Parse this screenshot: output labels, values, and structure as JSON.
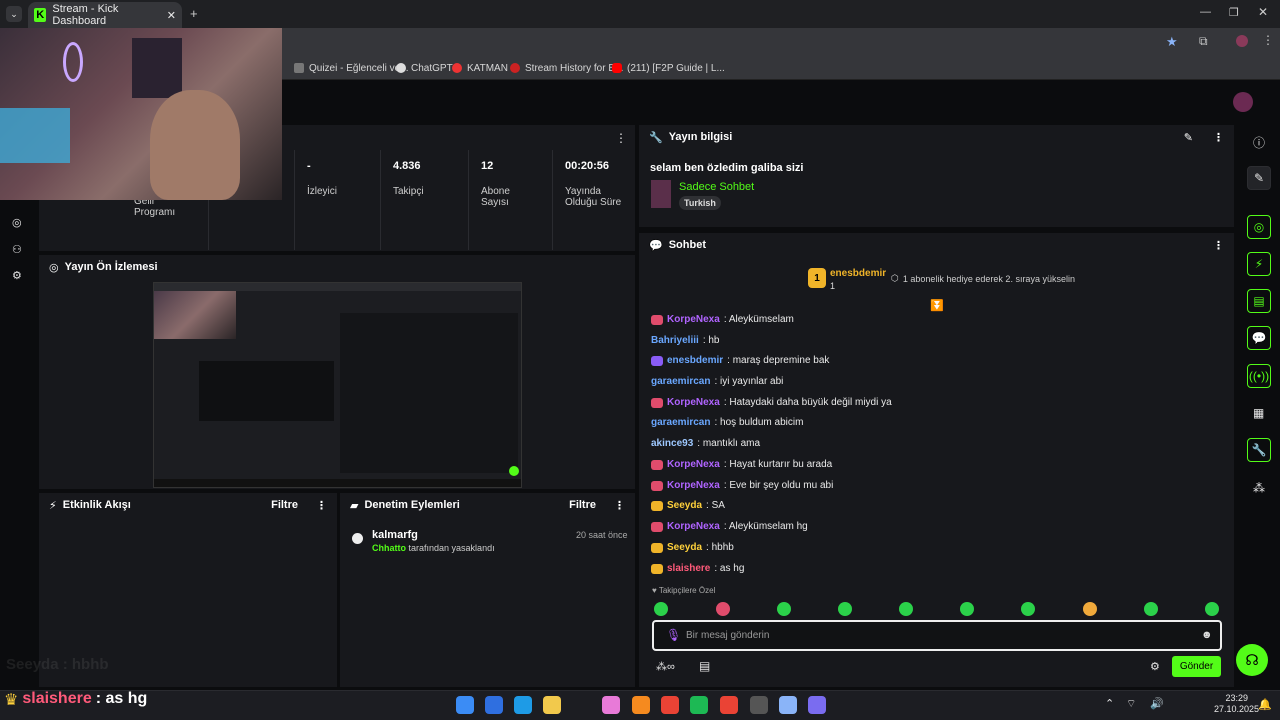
{
  "browser": {
    "tab_title": "Stream - Kick Dashboard",
    "bookmarks": [
      "Quizei - Eğlenceli ve...",
      "ChatGPT",
      "KATMAN",
      "Stream History for B...",
      "(211) [F2P Guide | L..."
    ]
  },
  "stats": [
    {
      "value": "",
      "label": "Gelir Programı"
    },
    {
      "value": "-",
      "label": "İzleyici"
    },
    {
      "value": "4.836",
      "label": "Takipçi"
    },
    {
      "value": "12",
      "label": "Abone Sayısı"
    },
    {
      "value": "00:20:56",
      "label": "Yayında Olduğu Süre"
    }
  ],
  "preview": {
    "title": "Yayın Ön İzlemesi"
  },
  "activity": {
    "title": "Etkinlik Akışı",
    "filter": "Filtre"
  },
  "moderation": {
    "title": "Denetim Eylemleri",
    "filter": "Filtre",
    "item": {
      "user": "kalmarfg",
      "by": "Chhatto",
      "action": "tarafından yasaklandı",
      "time": "20 saat önce"
    }
  },
  "stream_info": {
    "title": "Yayın bilgisi",
    "stream_title": "selam ben özledim galiba sizi",
    "category": "Sadece Sohbet",
    "language": "Turkish"
  },
  "chat": {
    "title": "Sohbet",
    "pinned_user": "enesbdemir",
    "pinned_count": "1",
    "gift_text": "1 abonelik hediye ederek 2. sıraya yükselin",
    "messages": [
      {
        "user": "KorpeNexa",
        "color": "#b064ff",
        "text": ": Aleykümselam"
      },
      {
        "user": "Bahriyeliii",
        "color": "#6aa7ff",
        "text": ": hb"
      },
      {
        "user": "enesbdemir",
        "color": "#6aa7ff",
        "text": ": maraş depremine bak"
      },
      {
        "user": "garaemircan",
        "color": "#6aa7ff",
        "text": ": iyi yayınlar abi"
      },
      {
        "user": "KorpeNexa",
        "color": "#b064ff",
        "text": ": Hataydaki daha büyük değil miydi ya"
      },
      {
        "user": "garaemircan",
        "color": "#6aa7ff",
        "text": ": hoş buldum abicim"
      },
      {
        "user": "akince93",
        "color": "#9ec8ff",
        "text": ": mantıklı ama"
      },
      {
        "user": "KorpeNexa",
        "color": "#b064ff",
        "text": ": Hayat kurtarır bu arada"
      },
      {
        "user": "KorpeNexa",
        "color": "#b064ff",
        "text": ": Eve bir şey oldu mu abi"
      },
      {
        "user": "Seeyda",
        "color": "#ffd13b",
        "text": ": SA"
      },
      {
        "user": "KorpeNexa",
        "color": "#b064ff",
        "text": ": Aleykümselam hg"
      },
      {
        "user": "Seeyda",
        "color": "#ffd13b",
        "text": ": hbhb"
      },
      {
        "user": "slaishere",
        "color": "#ff5a7a",
        "text": ": as hg"
      }
    ],
    "followers_only": "Takipçilere Özel",
    "input_placeholder": "Bir mesaj gönderin",
    "send_label": "Gönder"
  },
  "overlay": {
    "line1": "Seeyda : hbhb",
    "line2_user": "slaishere",
    "line2_text": ": as hg"
  },
  "taskbar": {
    "time": "23:29",
    "date": "27.10.2025"
  }
}
